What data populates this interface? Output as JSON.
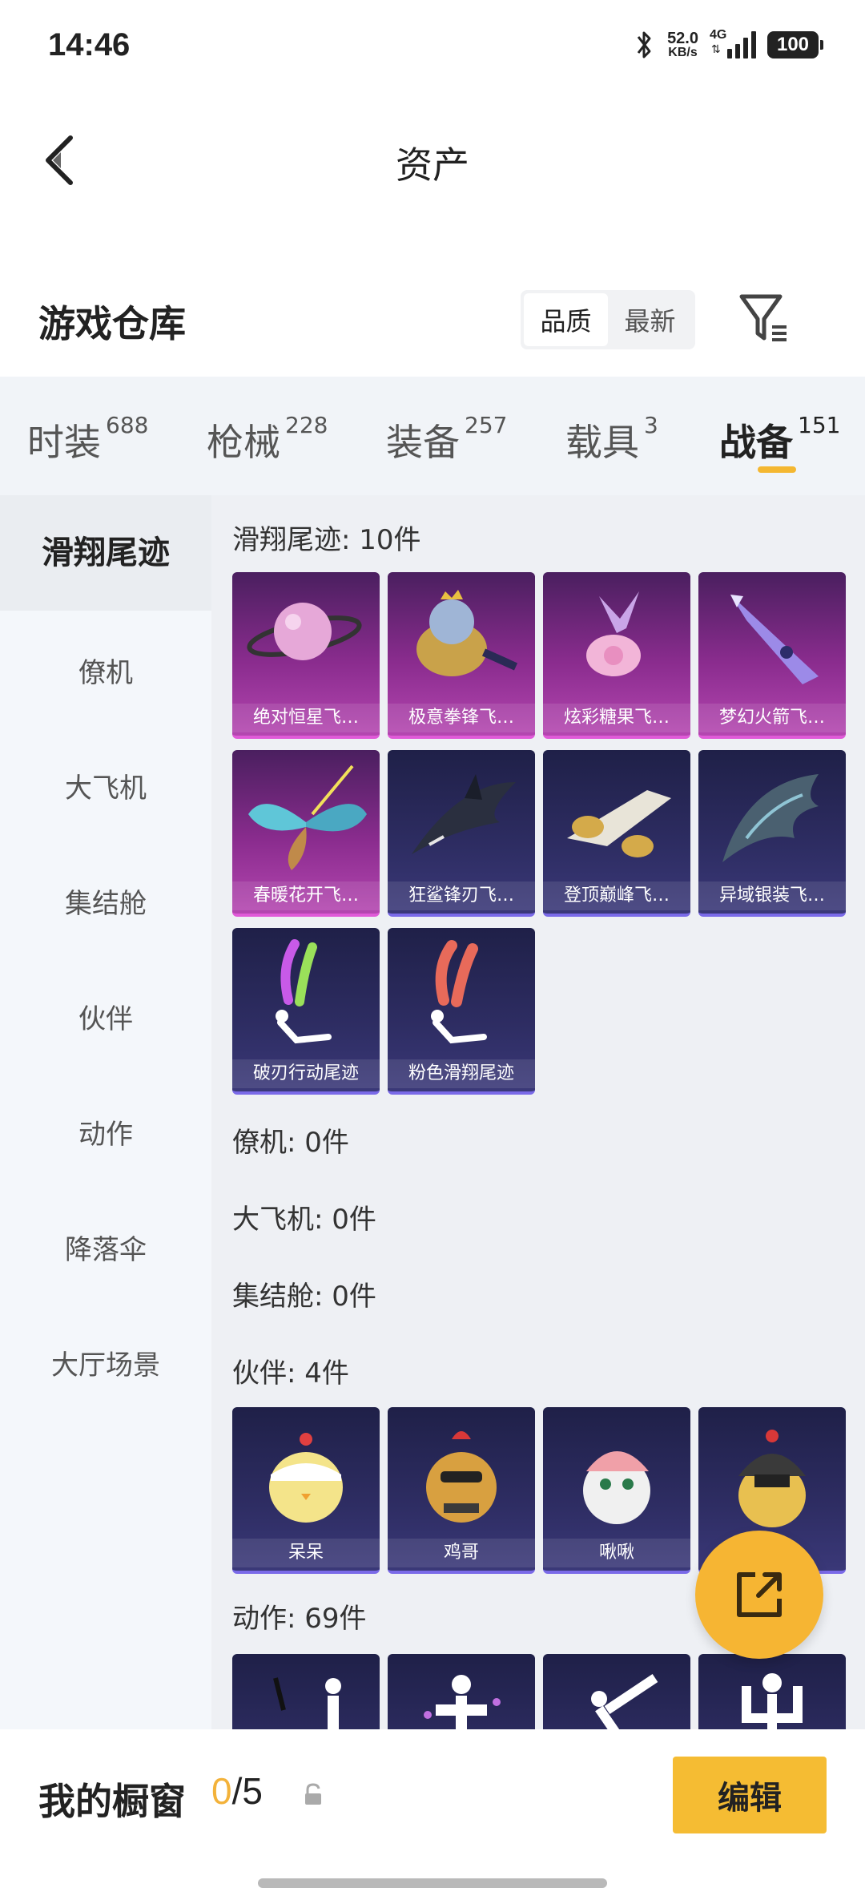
{
  "status_bar": {
    "time": "14:46",
    "net_speed_value": "52.0",
    "net_speed_unit": "KB/s",
    "network": "4G",
    "battery": "100"
  },
  "header": {
    "title": "资产",
    "back_icon": "chevron-left-icon"
  },
  "warehouse": {
    "title": "游戏仓库",
    "sort_options": [
      "品质",
      "最新"
    ],
    "sort_selected": "品质",
    "filter_icon": "filter-icon"
  },
  "category_tabs": [
    {
      "label": "时装",
      "count": "688"
    },
    {
      "label": "枪械",
      "count": "228"
    },
    {
      "label": "装备",
      "count": "257"
    },
    {
      "label": "载具",
      "count": "3"
    },
    {
      "label": "战备",
      "count": "151"
    }
  ],
  "active_tab": "战备",
  "sidebar": {
    "items": [
      "滑翔尾迹",
      "僚机",
      "大飞机",
      "集结舱",
      "伙伴",
      "动作",
      "降落伞",
      "大厅场景"
    ],
    "active": "滑翔尾迹"
  },
  "sections": {
    "glide_trail": {
      "label": "滑翔尾迹: 10件",
      "items": [
        "绝对恒星飞…",
        "极意拳锋飞…",
        "炫彩糖果飞…",
        "梦幻火箭飞…",
        "春暖花开飞…",
        "狂鲨锋刃飞…",
        "登顶巅峰飞…",
        "异域银装飞…",
        "破刃行动尾迹",
        "粉色滑翔尾迹"
      ]
    },
    "wingman": {
      "label": "僚机: 0件"
    },
    "big_plane": {
      "label": "大飞机: 0件"
    },
    "assembly_pod": {
      "label": "集结舱: 0件"
    },
    "companion": {
      "label": "伙伴: 4件",
      "items": [
        "呆呆",
        "鸡哥",
        "啾啾",
        ""
      ]
    },
    "emote": {
      "label": "动作: 69件"
    }
  },
  "bottom_bar": {
    "showcase_label": "我的橱窗",
    "showcase_current": "0",
    "showcase_total": "/5",
    "edit_label": "编辑"
  },
  "colors": {
    "accent": "#f5bc33",
    "card_pink": "#8a2c8e",
    "card_blue": "#2e2d63"
  }
}
